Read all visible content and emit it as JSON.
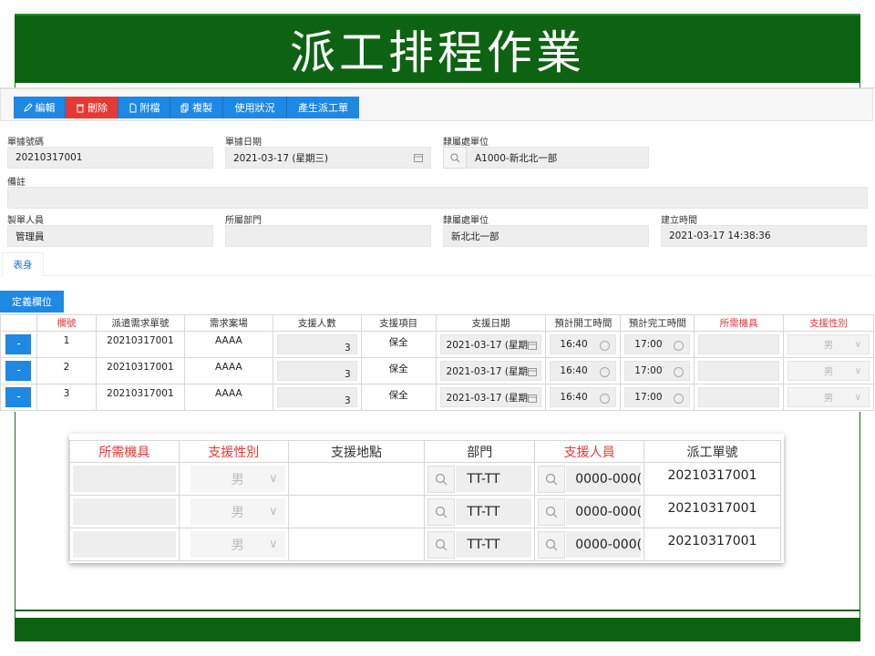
{
  "slide": {
    "title": "派工排程作業"
  },
  "toolbar": {
    "edit": "編輯",
    "delete": "刪除",
    "attach": "附檔",
    "copy": "複製",
    "usage": "使用狀況",
    "generate": "產生派工單"
  },
  "form": {
    "doc_no_label": "單據號碼",
    "doc_no_value": "20210317001",
    "doc_date_label": "單據日期",
    "doc_date_value": "2021-03-17 (星期三)",
    "unit_label": "隸屬處單位",
    "unit_value": "A1000-新北北一部",
    "note_label": "備註",
    "note_value": "",
    "creator_label": "製單人員",
    "creator_value": "管理員",
    "dept_label": "所屬部門",
    "dept_value": "",
    "unit2_label": "隸屬處單位",
    "unit2_value": "新北北一部",
    "created_label": "建立時間",
    "created_value": "2021-03-17 14:38:36"
  },
  "tabs": {
    "body": "表身"
  },
  "grid": {
    "define_button": "定義欄位",
    "headers": [
      "欄號",
      "派遣需求單號",
      "需求案場",
      "支援人數",
      "支援項目",
      "支援日期",
      "預計開工時間",
      "預計完工時間",
      "所需機具",
      "支援性別"
    ],
    "row_button": "-",
    "rows": [
      {
        "no": "1",
        "req_no": "20210317001",
        "site": "AAAA",
        "count": "3",
        "item": "保全",
        "date": "2021-03-17 (星期",
        "start": "16:40",
        "end": "17:00",
        "equip": "",
        "gender": "男"
      },
      {
        "no": "2",
        "req_no": "20210317001",
        "site": "AAAA",
        "count": "3",
        "item": "保全",
        "date": "2021-03-17 (星期",
        "start": "16:40",
        "end": "17:00",
        "equip": "",
        "gender": "男"
      },
      {
        "no": "3",
        "req_no": "20210317001",
        "site": "AAAA",
        "count": "3",
        "item": "保全",
        "date": "2021-03-17 (星期",
        "start": "16:40",
        "end": "17:00",
        "equip": "",
        "gender": "男"
      }
    ]
  },
  "zoom": {
    "headers": [
      "所需機具",
      "支援性別",
      "支援地點",
      "部門",
      "支援人員",
      "派工單號"
    ],
    "rows": [
      {
        "equip": "",
        "gender": "男",
        "location": "",
        "dept": "TT-TT",
        "staff": "0000-000(",
        "dispatch_no": "20210317001"
      },
      {
        "equip": "",
        "gender": "男",
        "location": "",
        "dept": "TT-TT",
        "staff": "0000-000(",
        "dispatch_no": "20210317001"
      },
      {
        "equip": "",
        "gender": "男",
        "location": "",
        "dept": "TT-TT",
        "staff": "0000-000(",
        "dispatch_no": "20210317001"
      }
    ]
  },
  "colors": {
    "band_green": "#0e6312",
    "primary_blue": "#1e88e5",
    "danger_red": "#e53935",
    "required_red": "#e53935"
  }
}
